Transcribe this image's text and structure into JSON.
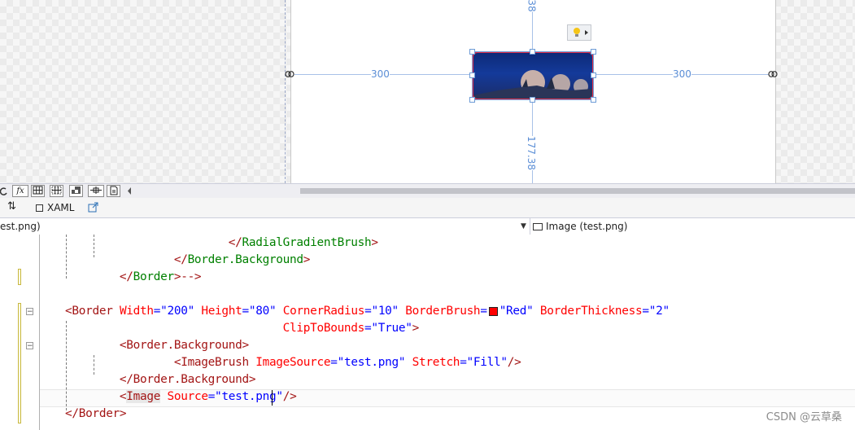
{
  "designer": {
    "top_label": "38",
    "left_margin_label": "300",
    "right_margin_label": "300",
    "bottom_margin_label": "177.38"
  },
  "toolbar": {
    "fx_label": "fx",
    "xaml_tab_label": "XAML",
    "swap_label": "⇅"
  },
  "navbar": {
    "left_selector": "est.png)",
    "right_selector": "Image (test.png)"
  },
  "code": {
    "lines": [
      {
        "indent": "      ",
        "parts": [
          [
            "br",
            "</"
          ],
          [
            "cm",
            "RadialGradientBrush"
          ],
          [
            "br",
            ">"
          ]
        ]
      },
      {
        "indent": "    ",
        "parts": [
          [
            "br",
            "</"
          ],
          [
            "cm",
            "Border.Background"
          ],
          [
            "br",
            ">"
          ]
        ]
      },
      {
        "indent": "  ",
        "parts": [
          [
            "br",
            "</"
          ],
          [
            "cm",
            "Border"
          ],
          [
            "br",
            ">-->"
          ]
        ]
      },
      {
        "indent": "",
        "parts": []
      },
      {
        "indent": "",
        "parts": [
          [
            "br",
            "<"
          ],
          [
            "br",
            "Border"
          ],
          [
            "tx",
            " "
          ],
          [
            "at",
            "Width"
          ],
          [
            "va",
            "=\"200\""
          ],
          [
            "tx",
            " "
          ],
          [
            "at",
            "Height"
          ],
          [
            "va",
            "=\"80\""
          ],
          [
            "tx",
            " "
          ],
          [
            "at",
            "CornerRadius"
          ],
          [
            "va",
            "=\"10\""
          ],
          [
            "tx",
            " "
          ],
          [
            "at",
            "BorderBrush"
          ],
          [
            "va",
            "="
          ],
          [
            "swatch",
            ""
          ],
          [
            "va",
            "\"Red\""
          ],
          [
            "tx",
            " "
          ],
          [
            "at",
            "BorderThickness"
          ],
          [
            "va",
            "=\"2\""
          ]
        ]
      },
      {
        "indent": "        ",
        "parts": [
          [
            "at",
            "ClipToBounds"
          ],
          [
            "va",
            "=\"True\""
          ],
          [
            "br",
            ">"
          ]
        ]
      },
      {
        "indent": "  ",
        "parts": [
          [
            "br",
            "<"
          ],
          [
            "br",
            "Border.Background"
          ],
          [
            "br",
            ">"
          ]
        ]
      },
      {
        "indent": "    ",
        "parts": [
          [
            "br",
            "<"
          ],
          [
            "br",
            "ImageBrush"
          ],
          [
            "tx",
            " "
          ],
          [
            "at",
            "ImageSource"
          ],
          [
            "va",
            "=\"test.png\""
          ],
          [
            "tx",
            " "
          ],
          [
            "at",
            "Stretch"
          ],
          [
            "va",
            "=\"Fill\""
          ],
          [
            "br",
            "/>"
          ]
        ]
      },
      {
        "indent": "  ",
        "parts": [
          [
            "br",
            "</"
          ],
          [
            "br",
            "Border.Background"
          ],
          [
            "br",
            ">"
          ]
        ]
      },
      {
        "indent": "  ",
        "parts": [
          [
            "br",
            "<"
          ],
          [
            "br",
            "Image"
          ],
          [
            "tx",
            " "
          ],
          [
            "at",
            "Source"
          ],
          [
            "va",
            "=\"test.png\""
          ],
          [
            "br",
            "/>"
          ]
        ]
      },
      {
        "indent": "",
        "parts": [
          [
            "br",
            "</"
          ],
          [
            "br",
            "Border"
          ],
          [
            "br",
            ">"
          ]
        ]
      }
    ]
  },
  "watermark": "CSDN @云草桑",
  "colors": {
    "selection": "#6c9bd6",
    "border_red": "#e0304a",
    "dimension_text": "#5b8ed6"
  }
}
